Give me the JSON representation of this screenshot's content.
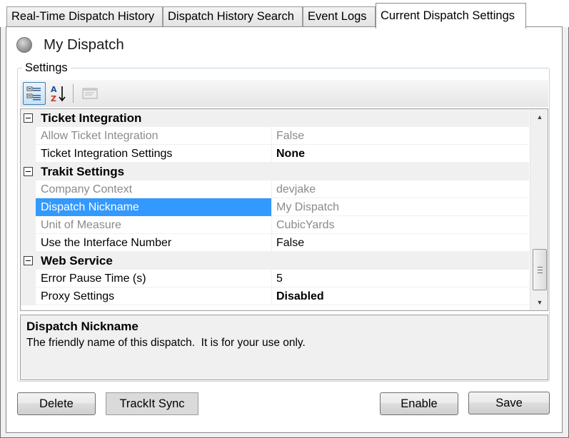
{
  "tabs": [
    {
      "label": "Real-Time Dispatch History"
    },
    {
      "label": "Dispatch History Search"
    },
    {
      "label": "Event Logs"
    },
    {
      "label": "Current Dispatch Settings"
    }
  ],
  "dispatch": {
    "name": "My Dispatch",
    "status_color": "#9a9a9a"
  },
  "settings_group": {
    "label": "Settings"
  },
  "toolbar": {
    "categorized_icon": "categorized-list-icon",
    "alphabetical_icon": "sort-az-icon",
    "property_pages_icon": "property-pages-icon"
  },
  "grid": {
    "categories": [
      {
        "label": "Ticket Integration",
        "rows": [
          {
            "name": "Allow Ticket Integration",
            "value": "False",
            "disabled": true,
            "bold": false
          },
          {
            "name": "Ticket Integration Settings",
            "value": "None",
            "disabled": false,
            "bold": true
          }
        ]
      },
      {
        "label": "Trakit Settings",
        "rows": [
          {
            "name": "Company Context",
            "value": "devjake",
            "disabled": true,
            "bold": false
          },
          {
            "name": "Dispatch Nickname",
            "value": "My Dispatch",
            "disabled": true,
            "bold": false,
            "selected": true
          },
          {
            "name": "Unit of Measure",
            "value": "CubicYards",
            "disabled": true,
            "bold": false
          },
          {
            "name": "Use the Interface Number",
            "value": "False",
            "disabled": false,
            "bold": false
          }
        ]
      },
      {
        "label": "Web Service",
        "rows": [
          {
            "name": "Error Pause Time (s)",
            "value": "5",
            "disabled": false,
            "bold": false
          },
          {
            "name": "Proxy Settings",
            "value": "Disabled",
            "disabled": false,
            "bold": true
          }
        ]
      }
    ]
  },
  "description": {
    "title": "Dispatch Nickname",
    "text": "The friendly name of this dispatch.  It is for your use only."
  },
  "buttons": {
    "delete": "Delete",
    "sync": "TrackIt Sync",
    "enable": "Enable",
    "save": "Save"
  },
  "colors": {
    "selection": "#3399ff",
    "disabled_text": "#8a8a8a",
    "category_bg": "#f0f0f0"
  }
}
